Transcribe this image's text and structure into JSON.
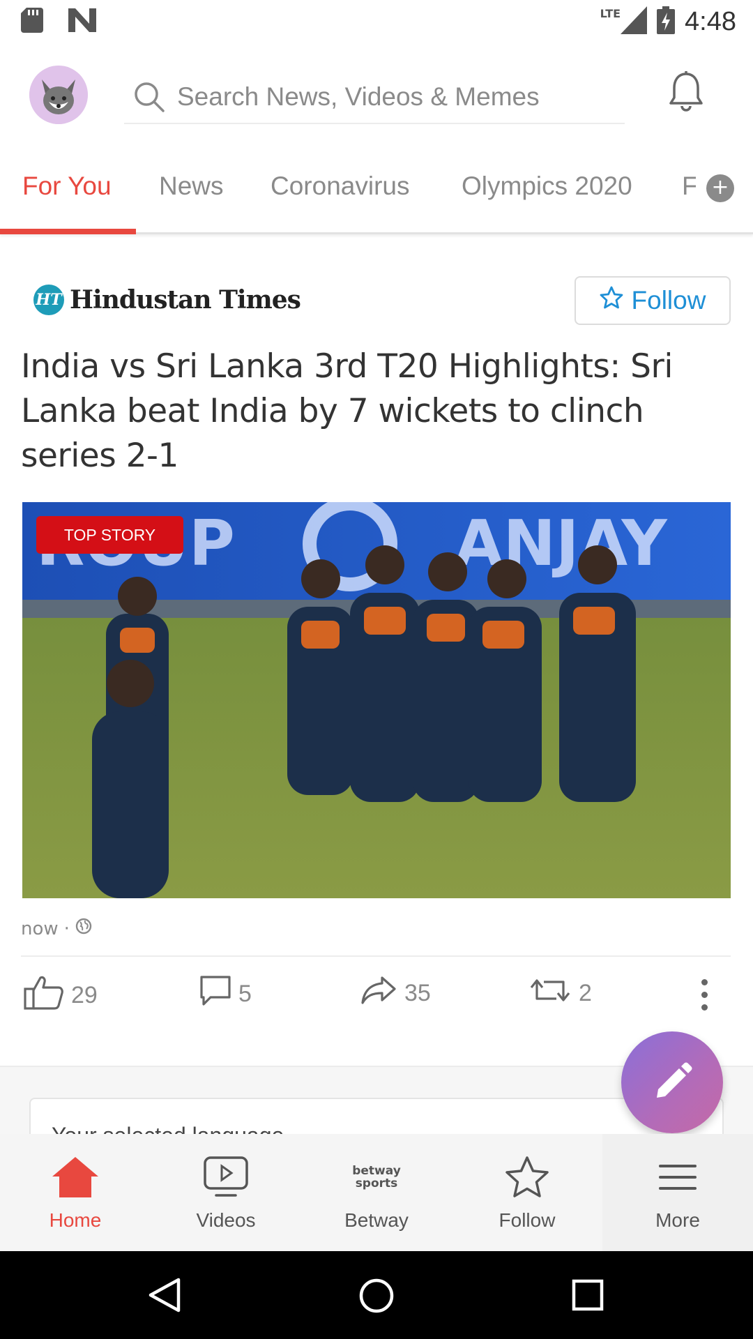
{
  "status_bar": {
    "time": "4:48",
    "network": "LTE",
    "icons": [
      "sd-card-icon",
      "n-logo-icon",
      "signal-icon",
      "battery-charging-icon"
    ]
  },
  "header": {
    "search_placeholder": "Search News, Videos & Memes",
    "icons": [
      "avatar-fox-icon",
      "search-icon",
      "bell-icon"
    ]
  },
  "tabs": {
    "items": [
      {
        "label": "For You",
        "active": true
      },
      {
        "label": "News",
        "active": false
      },
      {
        "label": "Coronavirus",
        "active": false
      },
      {
        "label": "Olympics 2020",
        "active": false
      },
      {
        "label": "F",
        "active": false
      }
    ],
    "accent": "#e8483f"
  },
  "card": {
    "publisher_badge": "HT",
    "publisher": "Hindustan Times",
    "follow_label": "Follow",
    "headline": "India vs Sri Lanka 3rd T20 Highlights: Sri Lanka beat India by 7 wickets to clinch series 2-1",
    "badge": "TOP STORY",
    "time": "now",
    "separator": "·",
    "actions": {
      "likes": "29",
      "comments": "5",
      "shares": "35",
      "reposts": "2"
    }
  },
  "language_card": {
    "text": "Your selected language"
  },
  "bottom_nav": {
    "items": [
      {
        "label": "Home",
        "icon": "home-icon",
        "active": true
      },
      {
        "label": "Videos",
        "icon": "video-play-icon",
        "active": false
      },
      {
        "label": "Betway",
        "icon": "betway-sports-icon",
        "active": false
      },
      {
        "label": "Follow",
        "icon": "star-icon",
        "active": false
      },
      {
        "label": "More",
        "icon": "menu-icon",
        "active": false
      }
    ],
    "betway_logo_top": "betway",
    "betway_logo_bottom": "sports"
  },
  "colors": {
    "accent": "#e8483f",
    "follow_blue": "#1e8fd6",
    "badge_red": "#d40f16"
  }
}
